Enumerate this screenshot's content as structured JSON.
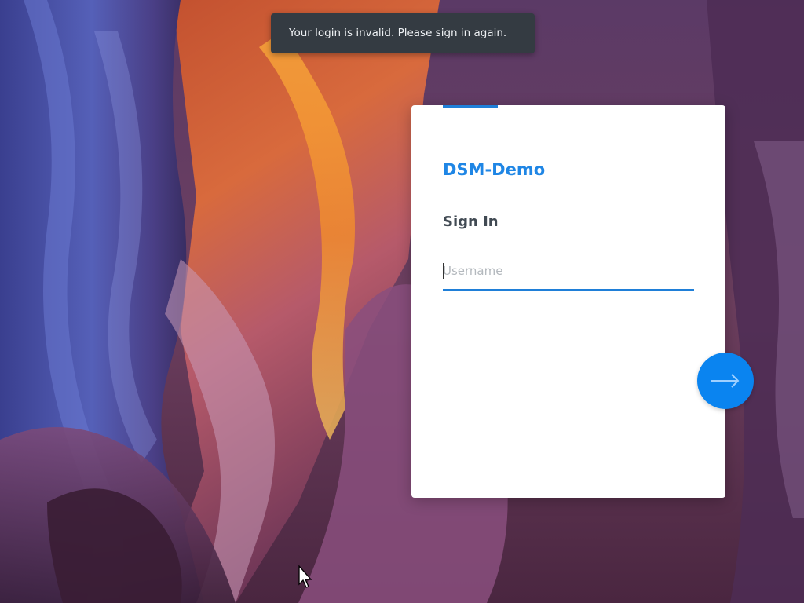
{
  "toast": {
    "message": "Your login is invalid. Please sign in again."
  },
  "login": {
    "server_name": "DSM-Demo",
    "heading": "Sign In",
    "username": {
      "value": "",
      "placeholder": "Username"
    },
    "next_button": {
      "icon": "arrow-right-icon"
    }
  },
  "colors": {
    "accent": "#1f86e5",
    "button": "#0a84f0",
    "toast_bg": "#343b42",
    "heading": "#414a53"
  }
}
